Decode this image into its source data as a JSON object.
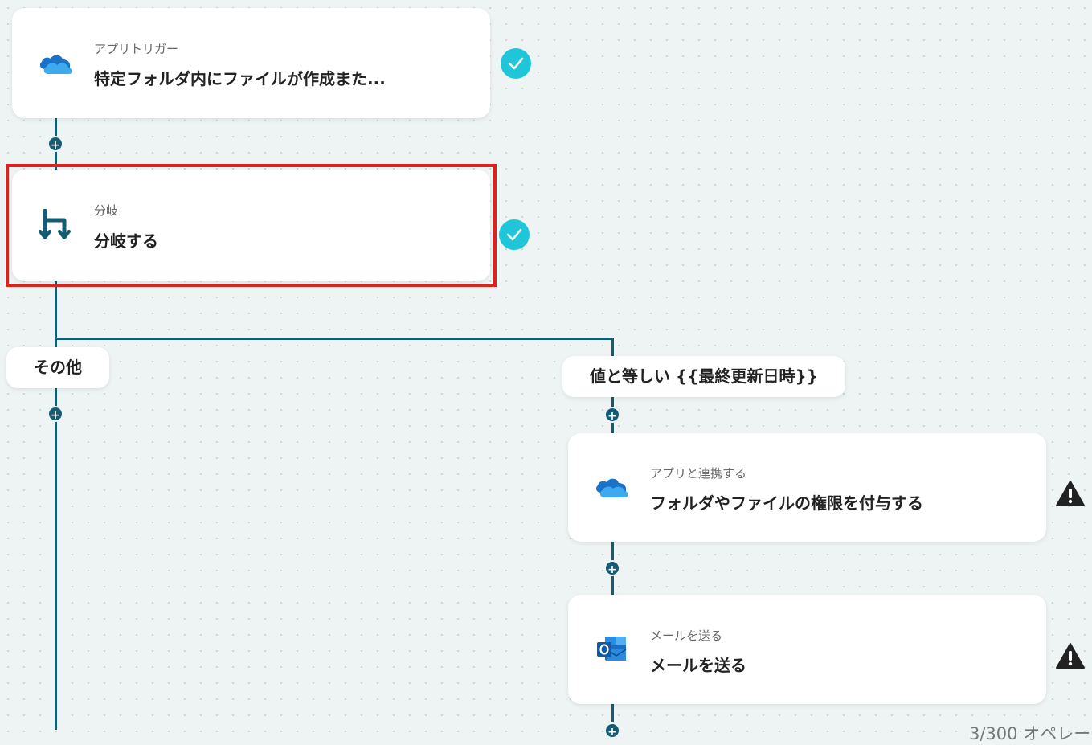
{
  "trigger": {
    "subtitle": "アプリトリガー",
    "title": "特定フォルダ内にファイルが作成また...",
    "icon": "onedrive-icon"
  },
  "branch": {
    "subtitle": "分岐",
    "title": "分岐する",
    "icon": "branch-icon"
  },
  "branch_labels": {
    "other": "その他",
    "condition": "値と等しい {{最終更新日時}}"
  },
  "permission_step": {
    "subtitle": "アプリと連携する",
    "title": "フォルダやファイルの権限を付与する",
    "icon": "onedrive-icon"
  },
  "mail_step": {
    "subtitle": "メールを送る",
    "title": "メールを送る",
    "icon": "outlook-icon"
  },
  "counter": "3/300 オペレー",
  "colors": {
    "line": "#135c73",
    "check": "#1fc6d9",
    "highlight": "#e0201f",
    "background": "#eef3f3"
  }
}
